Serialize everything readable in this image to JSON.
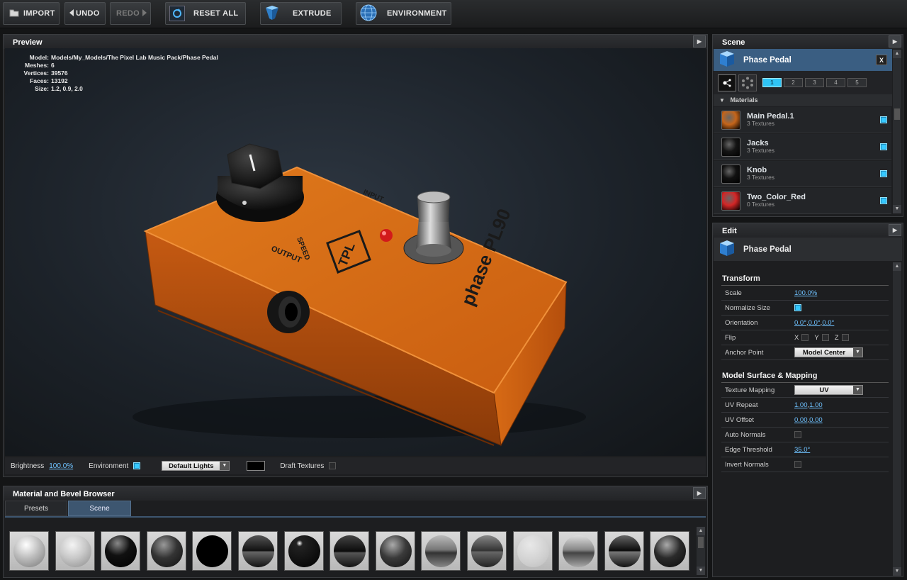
{
  "toolbar": {
    "import": "IMPORT",
    "undo": "UNDO",
    "redo": "REDO",
    "reset_all": "RESET ALL",
    "extrude": "EXTRUDE",
    "environment": "ENVIRONMENT"
  },
  "preview": {
    "title": "Preview",
    "info": {
      "model_label": "Model:",
      "model": "Models/My_Models/The Pixel Lab Music Pack/Phase Pedal",
      "meshes_label": "Meshes:",
      "meshes": "6",
      "vertices_label": "Vertices:",
      "vertices": "39576",
      "faces_label": "Faces:",
      "faces": "13192",
      "size_label": "Size:",
      "size": "1.2, 0.9, 2.0"
    },
    "pedal": {
      "speed": "SPEED",
      "output": "OUTPUT",
      "input": "INPUT",
      "logo": "TPL",
      "name": "phase PL90"
    },
    "bottom": {
      "brightness_label": "Brightness",
      "brightness_value": "100.0%",
      "environment_label": "Environment",
      "lights": "Default Lights",
      "draft_label": "Draft Textures"
    }
  },
  "scene": {
    "title": "Scene",
    "object": "Phase Pedal",
    "close": "X",
    "tabs": [
      "1",
      "2",
      "3",
      "4",
      "5"
    ],
    "materials_label": "Materials",
    "materials": [
      {
        "name": "Main Pedal.1",
        "textures": "3 Textures",
        "color": "#c5651a"
      },
      {
        "name": "Jacks",
        "textures": "3 Textures",
        "color": "#151515"
      },
      {
        "name": "Knob",
        "textures": "3 Textures",
        "color": "#111111"
      },
      {
        "name": "Two_Color_Red",
        "textures": "0 Textures",
        "color": "#d42626"
      }
    ]
  },
  "edit": {
    "title": "Edit",
    "object": "Phase Pedal",
    "transform_label": "Transform",
    "scale_label": "Scale",
    "scale": "100.0%",
    "normalize_label": "Normalize Size",
    "orientation_label": "Orientation",
    "orientation_x": "0.0°",
    "orientation_y": "0.0°",
    "orientation_z": "0.0°",
    "flip_label": "Flip",
    "flip_x": "X",
    "flip_y": "Y",
    "flip_z": "Z",
    "anchor_label": "Anchor Point",
    "anchor": "Model Center",
    "surface_label": "Model Surface & Mapping",
    "texture_mapping_label": "Texture Mapping",
    "texture_mapping": "UV",
    "uv_repeat_label": "UV Repeat",
    "uv_repeat_u": "1.00",
    "uv_repeat_v": "1.00",
    "uv_offset_label": "UV Offset",
    "uv_offset_u": "0.00",
    "uv_offset_v": "0.00",
    "auto_normals_label": "Auto Normals",
    "edge_threshold_label": "Edge Threshold",
    "edge_threshold": "35.0°",
    "invert_normals_label": "Invert Normals",
    "comma": ","
  },
  "browser": {
    "title": "Material and Bevel Browser",
    "tabs": [
      "Presets",
      "Scene"
    ]
  }
}
